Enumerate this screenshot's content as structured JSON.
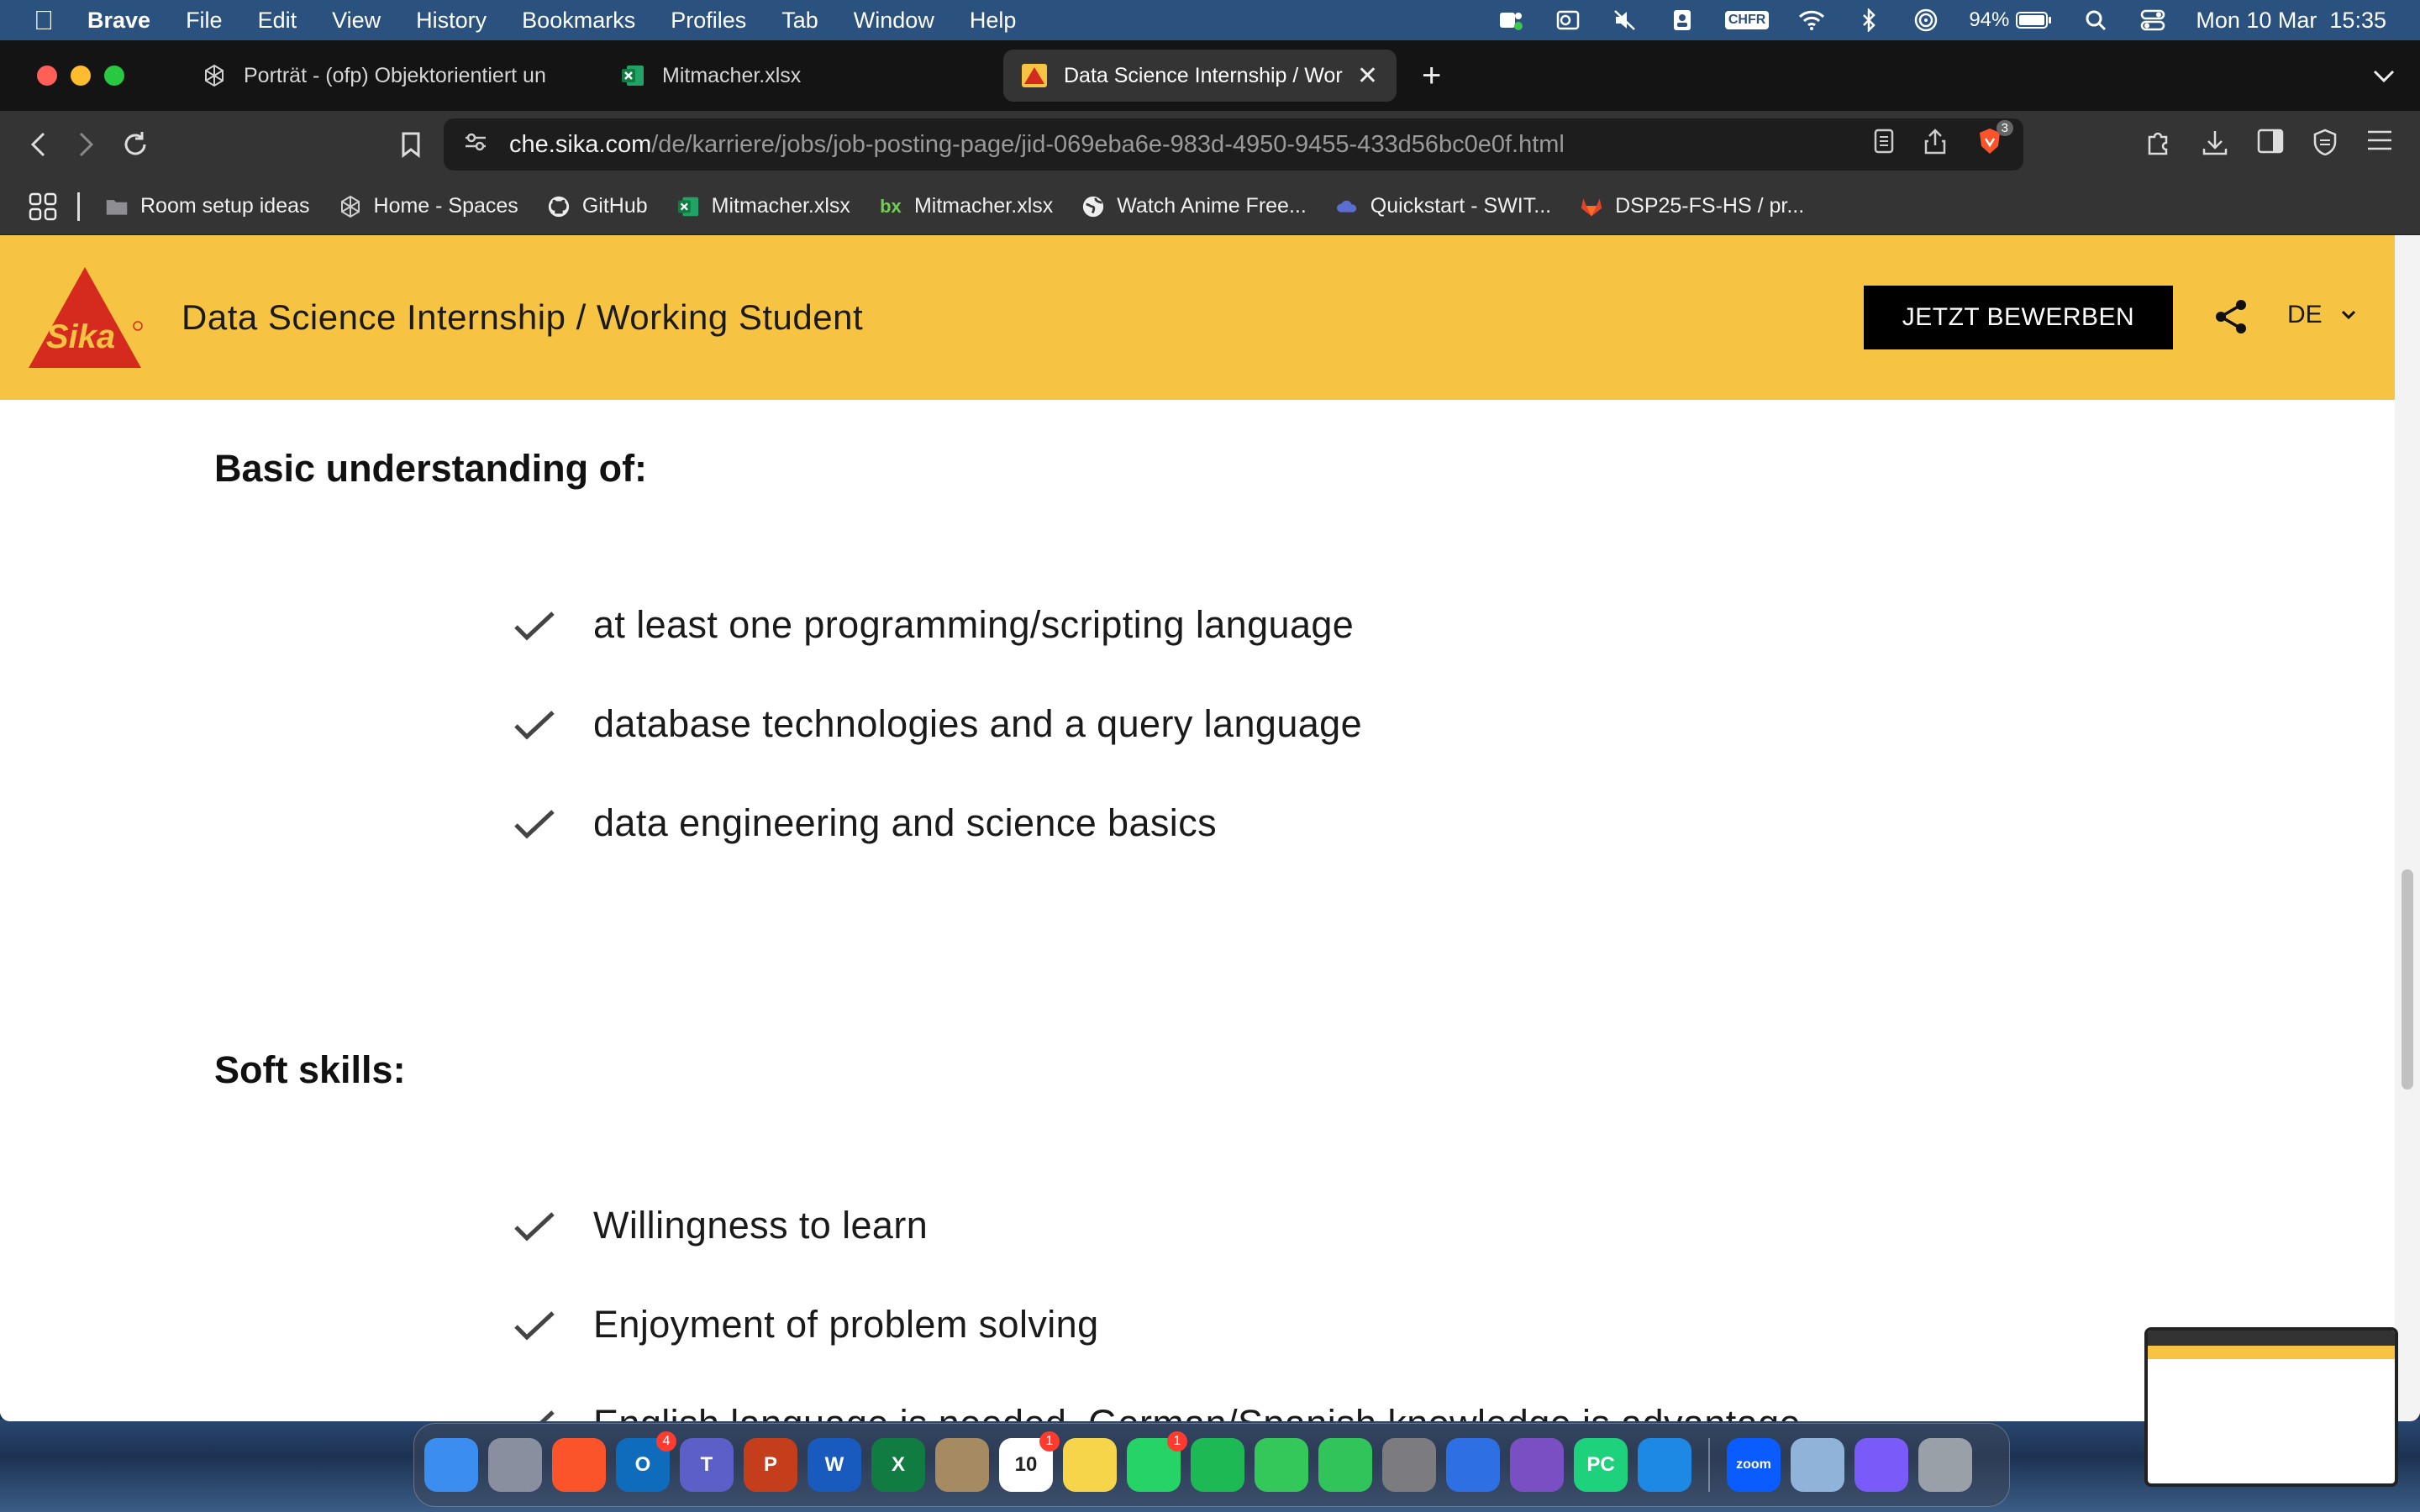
{
  "menubar": {
    "app_name": "Brave",
    "items": [
      "File",
      "Edit",
      "View",
      "History",
      "Bookmarks",
      "Profiles",
      "Tab",
      "Window",
      "Help"
    ],
    "battery": "94%",
    "keyboard_layout": "CHFR",
    "datetime": "Mon 10 Mar  15:35"
  },
  "tabs": [
    {
      "label": "Porträt - (ofp) Objektorientiert un",
      "icon": "perplexity-icon"
    },
    {
      "label": "Mitmacher.xlsx",
      "icon": "excel-icon"
    },
    {
      "label": "Data Science Internship / Wor",
      "icon": "sika-favicon",
      "active": true
    }
  ],
  "url": {
    "host": "che.sika.com",
    "path": "/de/karriere/jobs/job-posting-page/jid-069eba6e-983d-4950-9455-433d56bc0e0f.html"
  },
  "brave_shield_count": "3",
  "bookmarks": [
    {
      "label": "Room setup ideas",
      "icon": "folder-icon"
    },
    {
      "label": "Home - Spaces",
      "icon": "perplexity-icon"
    },
    {
      "label": "GitHub",
      "icon": "github-icon"
    },
    {
      "label": "Mitmacher.xlsx",
      "icon": "excel-icon"
    },
    {
      "label": "Mitmacher.xlsx",
      "icon": "bx-icon"
    },
    {
      "label": "Watch Anime Free...",
      "icon": "globe-icon"
    },
    {
      "label": "Quickstart - SWIT...",
      "icon": "cloud-icon"
    },
    {
      "label": "DSP25-FS-HS / pr...",
      "icon": "gitlab-icon"
    }
  ],
  "site_header": {
    "logo_text": "Sika",
    "job_title": "Data Science Internship / Working Student",
    "apply_label": "JETZT BEWERBEN",
    "language": "DE"
  },
  "sections": [
    {
      "title": "Basic understanding of:",
      "items": [
        "at least one programming/scripting language",
        "database technologies and a query language",
        "data engineering and science basics"
      ]
    },
    {
      "title": "Soft skills:",
      "items": [
        "Willingness to learn",
        "Enjoyment of problem solving",
        "English language is needed, German/Spanish knowledge is advantage"
      ]
    }
  ],
  "dock": {
    "apps": [
      {
        "name": "finder",
        "label": "",
        "color": "#3b8df0"
      },
      {
        "name": "launchpad",
        "label": "",
        "color": "#8a8fa0"
      },
      {
        "name": "brave",
        "label": "",
        "color": "#fb542b"
      },
      {
        "name": "outlook",
        "label": "O",
        "color": "#0f6cbd",
        "badge": "4"
      },
      {
        "name": "teams",
        "label": "T",
        "color": "#5b5fc7"
      },
      {
        "name": "powerpoint",
        "label": "P",
        "color": "#c43e1c"
      },
      {
        "name": "word",
        "label": "W",
        "color": "#185abd"
      },
      {
        "name": "excel",
        "label": "X",
        "color": "#107c41"
      },
      {
        "name": "contacts",
        "label": "",
        "color": "#a58a62"
      },
      {
        "name": "calendar",
        "label": "10",
        "color": "#ffffff",
        "badge": "1"
      },
      {
        "name": "notes",
        "label": "",
        "color": "#f7d54b"
      },
      {
        "name": "whatsapp",
        "label": "",
        "color": "#25d366",
        "badge": "1"
      },
      {
        "name": "spotify",
        "label": "",
        "color": "#1db954"
      },
      {
        "name": "messages",
        "label": "",
        "color": "#34c759"
      },
      {
        "name": "facetime",
        "label": "",
        "color": "#30c45a"
      },
      {
        "name": "system-settings",
        "label": "",
        "color": "#7c7c80"
      },
      {
        "name": "perplexity",
        "label": "",
        "color": "#2f6fe4"
      },
      {
        "name": "github-desktop",
        "label": "",
        "color": "#7b4fc4"
      },
      {
        "name": "pycharm",
        "label": "PC",
        "color": "#1ed17d"
      },
      {
        "name": "vscode",
        "label": "",
        "color": "#1e88e5"
      }
    ],
    "apps_after_separator": [
      {
        "name": "zoom",
        "label": "zoom",
        "color": "#0b5cff"
      },
      {
        "name": "preview",
        "label": "",
        "color": "#8fb3d9"
      },
      {
        "name": "app-store-like",
        "label": "",
        "color": "#7a5af8"
      },
      {
        "name": "trash",
        "label": "",
        "color": "#9aa0a8"
      }
    ]
  }
}
